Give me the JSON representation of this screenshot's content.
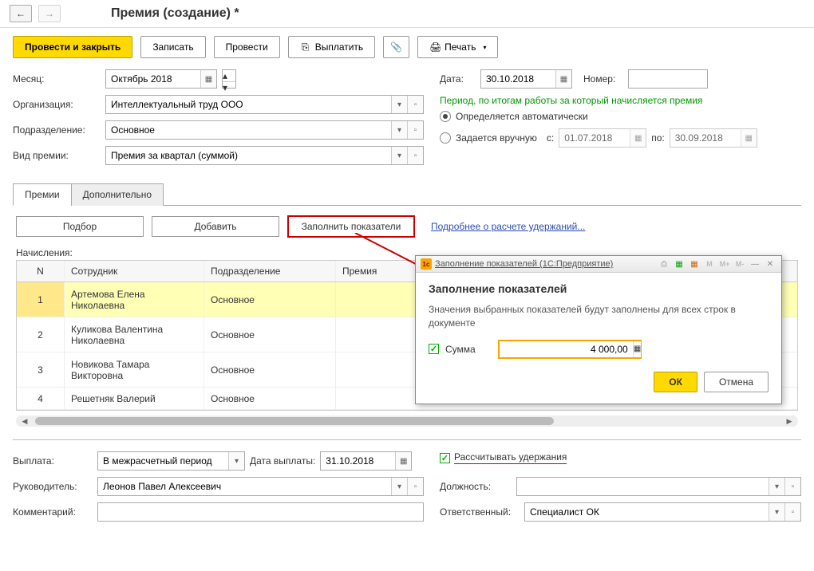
{
  "nav": {
    "back": "←",
    "fwd": "→"
  },
  "title": "Премия (создание) *",
  "toolbar": {
    "submit_close": "Провести и закрыть",
    "save": "Записать",
    "submit": "Провести",
    "pay": "Выплатить",
    "print": "Печать"
  },
  "form": {
    "month_label": "Месяц:",
    "month_value": "Октябрь 2018",
    "date_label": "Дата:",
    "date_value": "30.10.2018",
    "number_label": "Номер:",
    "number_value": "",
    "org_label": "Организация:",
    "org_value": "Интеллектуальный труд ООО",
    "dept_label": "Подразделение:",
    "dept_value": "Основное",
    "bonus_type_label": "Вид премии:",
    "bonus_type_value": "Премия за квартал (суммой)"
  },
  "period": {
    "header": "Период, по итогам работы за который начисляется премия",
    "auto_label": "Определяется автоматически",
    "manual_label": "Задается вручную",
    "from_label": "с:",
    "from_value": "01.07.2018",
    "to_label": "по:",
    "to_value": "30.09.2018"
  },
  "tabs": {
    "bonuses": "Премии",
    "additional": "Дополнительно"
  },
  "tab_toolbar": {
    "select": "Подбор",
    "add": "Добавить",
    "fill_indicators": "Заполнить показатели",
    "more_link": "Подробнее о расчете удержаний..."
  },
  "table": {
    "caption": "Начисления:",
    "headers": {
      "n": "N",
      "employee": "Сотрудник",
      "dept": "Подразделение",
      "bonus": "Премия"
    },
    "rows": [
      {
        "n": "1",
        "employee": "Артемова Елена Николаевна",
        "dept": "Основное"
      },
      {
        "n": "2",
        "employee": "Куликова Валентина Николаевна",
        "dept": "Основное"
      },
      {
        "n": "3",
        "employee": "Новикова Тамара Викторовна",
        "dept": "Основное"
      },
      {
        "n": "4",
        "employee": "Решетняк Валерий",
        "dept": "Основное"
      }
    ]
  },
  "bottom": {
    "payout_label": "Выплата:",
    "payout_value": "В межрасчетный период",
    "payout_date_label": "Дата выплаты:",
    "payout_date_value": "31.10.2018",
    "calc_deductions": "Рассчитывать удержания",
    "manager_label": "Руководитель:",
    "manager_value": "Леонов Павел Алексеевич",
    "position_label": "Должность:",
    "position_value": "",
    "comment_label": "Комментарий:",
    "comment_value": "",
    "responsible_label": "Ответственный:",
    "responsible_value": "Специалист ОК"
  },
  "popup": {
    "window_title": "Заполнение показателей (1С:Предприятие)",
    "heading": "Заполнение показателей",
    "description": "Значения выбранных показателей будут заполнены для всех строк в документе",
    "field_label": "Сумма",
    "field_value": "4 000,00",
    "ok": "ОК",
    "cancel": "Отмена",
    "m_labels": [
      "M",
      "M+",
      "M-"
    ]
  },
  "icons": {
    "calendar": "▦",
    "dropdown": "▾",
    "ext": "▫",
    "spin_up": "▴",
    "spin_down": "▾",
    "attach": "📎",
    "print": "🖨",
    "pay": "⎘",
    "close": "✕",
    "minimize": "—"
  }
}
